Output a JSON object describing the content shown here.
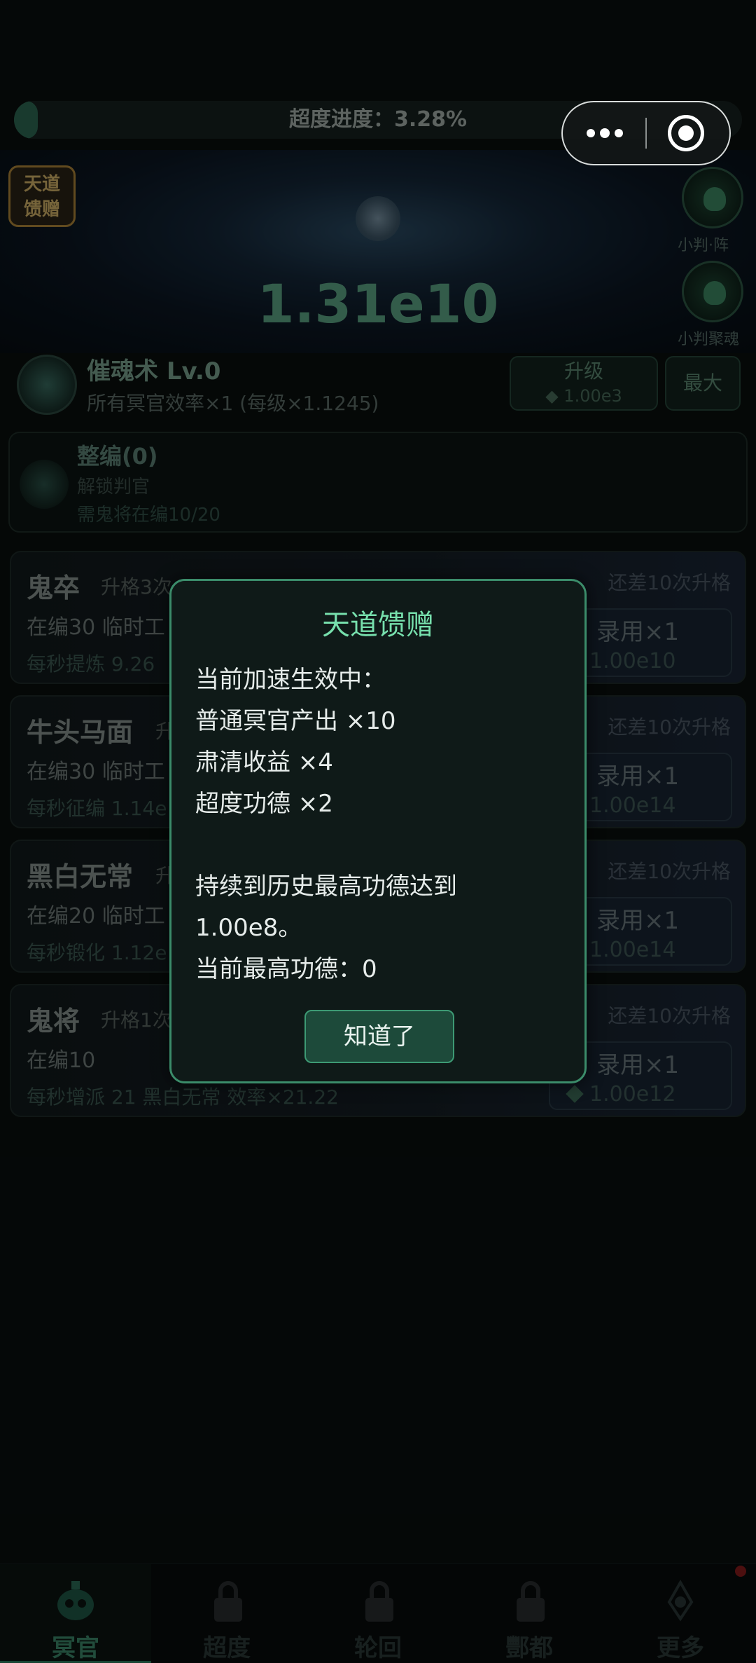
{
  "progress": {
    "label": "超度进度：3.28%",
    "value": 3.28
  },
  "hero": {
    "value": "1.31e10"
  },
  "gift_badge": {
    "line1": "天道",
    "line2": "馈赠"
  },
  "side_buttons": [
    {
      "label": "小判·阵",
      "icon": "formation-icon"
    },
    {
      "label": "小判聚魂",
      "icon": "soul-gather-icon"
    }
  ],
  "skill": {
    "name": "催魂术 Lv.0",
    "desc": "所有冥官效率×1 (每级×1.1245)",
    "upgrade_label": "升级",
    "upgrade_cost": "◆ 1.00e3",
    "max_label": "最大"
  },
  "formation": {
    "title": "整编(0)",
    "sub1": "解锁判官",
    "sub2": "需鬼将在编10/20"
  },
  "units": [
    {
      "name": "鬼卒",
      "tag": "升格3次",
      "line1": "在编30  临时工",
      "line2": "每秒提炼 9.26",
      "hint": "还差10次升格",
      "hire": "录用×1",
      "cost": "1.00e10"
    },
    {
      "name": "牛头马面",
      "tag": "升",
      "line1": "在编30  临时工",
      "line2": "每秒征编 1.14e",
      "hint": "还差10次升格",
      "hire": "录用×1",
      "cost": "1.00e14"
    },
    {
      "name": "黑白无常",
      "tag": "升",
      "line1": "在编20  临时工",
      "line2": "每秒锻化 1.12e",
      "hint": "还差10次升格",
      "hire": "录用×1",
      "cost": "1.00e14"
    },
    {
      "name": "鬼将",
      "tag": "升格1次",
      "line1": "在编10",
      "line2": "每秒增派 21 黑白无常  效率×21.22",
      "hint": "还差10次升格",
      "hire": "录用×1",
      "cost": "1.00e12"
    }
  ],
  "tabs": [
    {
      "label": "冥官",
      "active": true,
      "locked": false
    },
    {
      "label": "超度",
      "active": false,
      "locked": true
    },
    {
      "label": "轮回",
      "active": false,
      "locked": true
    },
    {
      "label": "酆都",
      "active": false,
      "locked": true
    },
    {
      "label": "更多",
      "active": false,
      "locked": false
    }
  ],
  "capsule": {
    "more_icon": "more-dots-icon",
    "close_icon": "target-close-icon"
  },
  "dialog": {
    "title": "天道馈赠",
    "lines": [
      "当前加速生效中：",
      "普通冥官产出 ×10",
      "肃清收益 ×4",
      "超度功德 ×2",
      "",
      "持续到历史最高功德达到",
      "1.00e8。",
      "当前最高功德：0"
    ],
    "ok_label": "知道了"
  },
  "colors": {
    "accent": "#77e0ad",
    "button": "#1d4a3a",
    "border": "#3b8c6a"
  }
}
